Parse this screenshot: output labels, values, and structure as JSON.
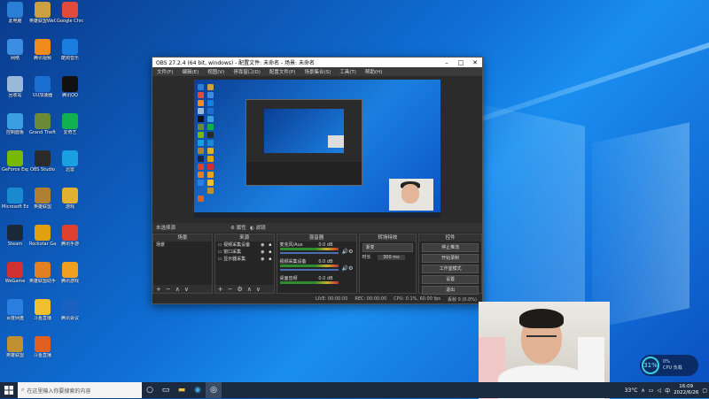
{
  "desktop_icons": [
    {
      "label": "此电脑",
      "color": "#2a7fd4",
      "icon": "computer-icon"
    },
    {
      "label": "英雄联盟WeGame版",
      "color": "#caa040",
      "icon": "lol-icon"
    },
    {
      "label": "Google Chrome",
      "color": "#e04b3b",
      "icon": "chrome-icon"
    },
    {
      "label": "网络",
      "color": "#3a8de0",
      "icon": "network-icon"
    },
    {
      "label": "腾讯视频",
      "color": "#f08a1a",
      "icon": "tencent-video-icon"
    },
    {
      "label": "酷狗音乐",
      "color": "#1a7ee0",
      "icon": "kugou-icon"
    },
    {
      "label": "回收站",
      "color": "#9ab8d8",
      "icon": "recycle-bin-icon"
    },
    {
      "label": "UU加速器",
      "color": "#1a6fd0",
      "icon": "uu-icon"
    },
    {
      "label": "腾讯QQ",
      "color": "#111111",
      "icon": "qq-icon"
    },
    {
      "label": "控制面板",
      "color": "#3a9ee0",
      "icon": "control-panel-icon"
    },
    {
      "label": "Grand Theft Auto V",
      "color": "#6a8a3a",
      "icon": "gta-icon"
    },
    {
      "label": "爱奇艺",
      "color": "#10b050",
      "icon": "iqiyi-icon"
    },
    {
      "label": "GeForce Experience",
      "color": "#76b900",
      "icon": "nvidia-icon"
    },
    {
      "label": "OBS Studio",
      "color": "#2a2a2a",
      "icon": "obs-icon"
    },
    {
      "label": "迅雷",
      "color": "#1aa0e0",
      "icon": "xunlei-icon"
    },
    {
      "label": "Microsoft Edge",
      "color": "#1a8ad0",
      "icon": "edge-icon"
    },
    {
      "label": "英雄联盟",
      "color": "#b08030",
      "icon": "league-icon"
    },
    {
      "label": "游戏",
      "color": "#e0b030",
      "icon": "folder-icon"
    },
    {
      "label": "Steam",
      "color": "#1b2838",
      "icon": "steam-icon"
    },
    {
      "label": "Rockstar Games",
      "color": "#e0a010",
      "icon": "rockstar-icon"
    },
    {
      "label": "腾讯手游",
      "color": "#e04030",
      "icon": "tencent-game-icon"
    },
    {
      "label": "WeGame",
      "color": "#d03030",
      "icon": "wegame-icon"
    },
    {
      "label": "英雄联盟助手",
      "color": "#e08020",
      "icon": "lol-helper-icon"
    },
    {
      "label": "腾讯游戏",
      "color": "#f0a020",
      "icon": "qq-game-icon"
    },
    {
      "label": "百度网盘",
      "color": "#2a7fe0",
      "icon": "baidu-icon"
    },
    {
      "label": "斗鱼直播",
      "color": "#f0c030",
      "icon": "douyu-icon"
    },
    {
      "label": "腾讯会议",
      "color": "#1a60c0",
      "icon": "meeting-icon"
    },
    {
      "label": "英雄联盟",
      "color": "#c09030",
      "icon": "lol2-icon"
    },
    {
      "label": "斗鱼直播",
      "color": "#e06020",
      "icon": "douyu2-icon"
    }
  ],
  "obs": {
    "title": "OBS 27.2.4 (64 bit, windows) - 配置文件: 未命名 - 场景: 未命名",
    "menu": [
      "文件(F)",
      "编辑(E)",
      "视图(V)",
      "停靠窗口(D)",
      "配置文件(P)",
      "场景集合(S)",
      "工具(T)",
      "帮助(H)"
    ],
    "preview_label": "未选择源",
    "properties_btn": "属性",
    "filters_btn": "滤镜",
    "docks": {
      "scenes": {
        "title": "场景",
        "items": [
          "场景"
        ]
      },
      "sources": {
        "title": "来源",
        "items": [
          "视频采集设备",
          "窗口采集",
          "显示器采集"
        ]
      },
      "mixer": {
        "title": "混音器",
        "tracks": [
          {
            "name": "麦克风/Aux",
            "db": "0.0 dB"
          },
          {
            "name": "视频采集设备",
            "db": "0.0 dB"
          },
          {
            "name": "桌面音频",
            "db": "0.0 dB"
          }
        ]
      },
      "transitions": {
        "title": "转场特效",
        "mode": "渐变",
        "duration_label": "时长",
        "duration": "300 ms"
      },
      "controls": {
        "title": "控件",
        "buttons": [
          "停止推流",
          "开始录制",
          "工作室模式",
          "设置",
          "退出"
        ]
      }
    },
    "status": {
      "live": "LIVE: 00:00:00",
      "rec": "REC: 00:00:00",
      "cpu": "CPU: 0.1%, 60.00 fps",
      "dropped": "丢帧 0 (0.0%)"
    }
  },
  "cpu_widget": {
    "percent": "31%",
    "line1": "0%",
    "line2": "CPU 负载"
  },
  "taskbar": {
    "search_placeholder": "在这里输入你要搜索的内容",
    "clock_time": "16:09",
    "clock_date": "2022/6/26",
    "weather": "33°C"
  }
}
